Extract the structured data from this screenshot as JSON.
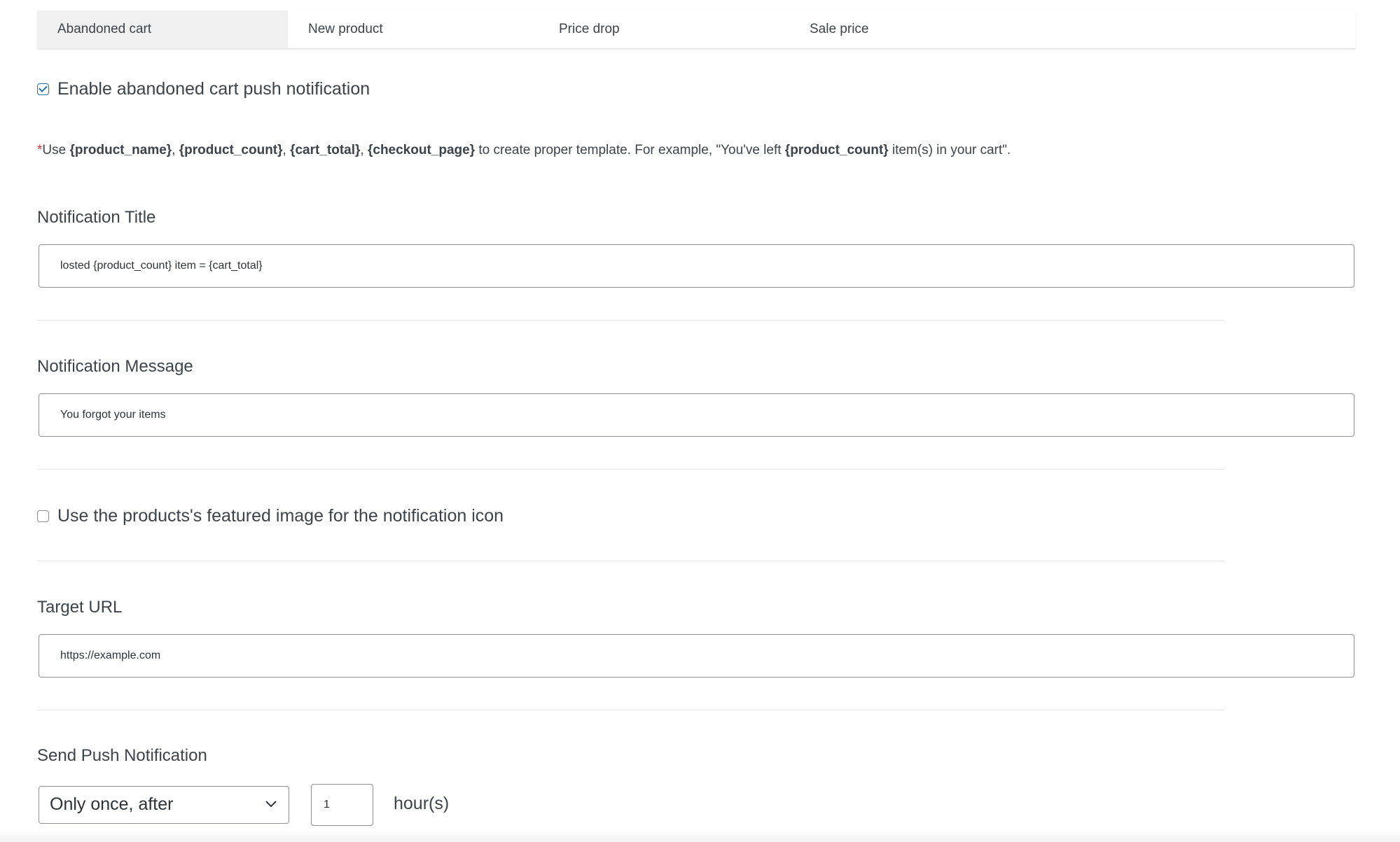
{
  "tabs": [
    {
      "label": "Abandoned cart",
      "active": true
    },
    {
      "label": "New product",
      "active": false
    },
    {
      "label": "Price drop",
      "active": false
    },
    {
      "label": "Sale price",
      "active": false
    }
  ],
  "enable_checkbox": {
    "label": "Enable abandoned cart push notification",
    "checked": true
  },
  "hint": {
    "asterisk": "*",
    "use": "Use ",
    "ph1": "{product_name}",
    "sep1": ", ",
    "ph2": "{product_count}",
    "sep2": ", ",
    "ph3": "{cart_total}",
    "sep3": ", ",
    "ph4": "{checkout_page}",
    "mid": " to create proper template. For example, \"You've left ",
    "ph5": "{product_count}",
    "end": " item(s) in your cart\"."
  },
  "notification_title": {
    "label": "Notification Title",
    "value": "losted {product_count} item = {cart_total}"
  },
  "notification_message": {
    "label": "Notification Message",
    "value": "You forgot your items"
  },
  "featured_image_checkbox": {
    "label": "Use the products's featured image for the notification icon",
    "checked": false
  },
  "target_url": {
    "label": "Target URL",
    "value": "https://example.com"
  },
  "send_push": {
    "label": "Send Push Notification",
    "frequency": "Only once, after",
    "amount": "1",
    "unit": "hour(s)"
  },
  "colors": {
    "accent": "#2271b1",
    "required": "#d63638",
    "active_tab_bg": "#f0f0f1"
  }
}
